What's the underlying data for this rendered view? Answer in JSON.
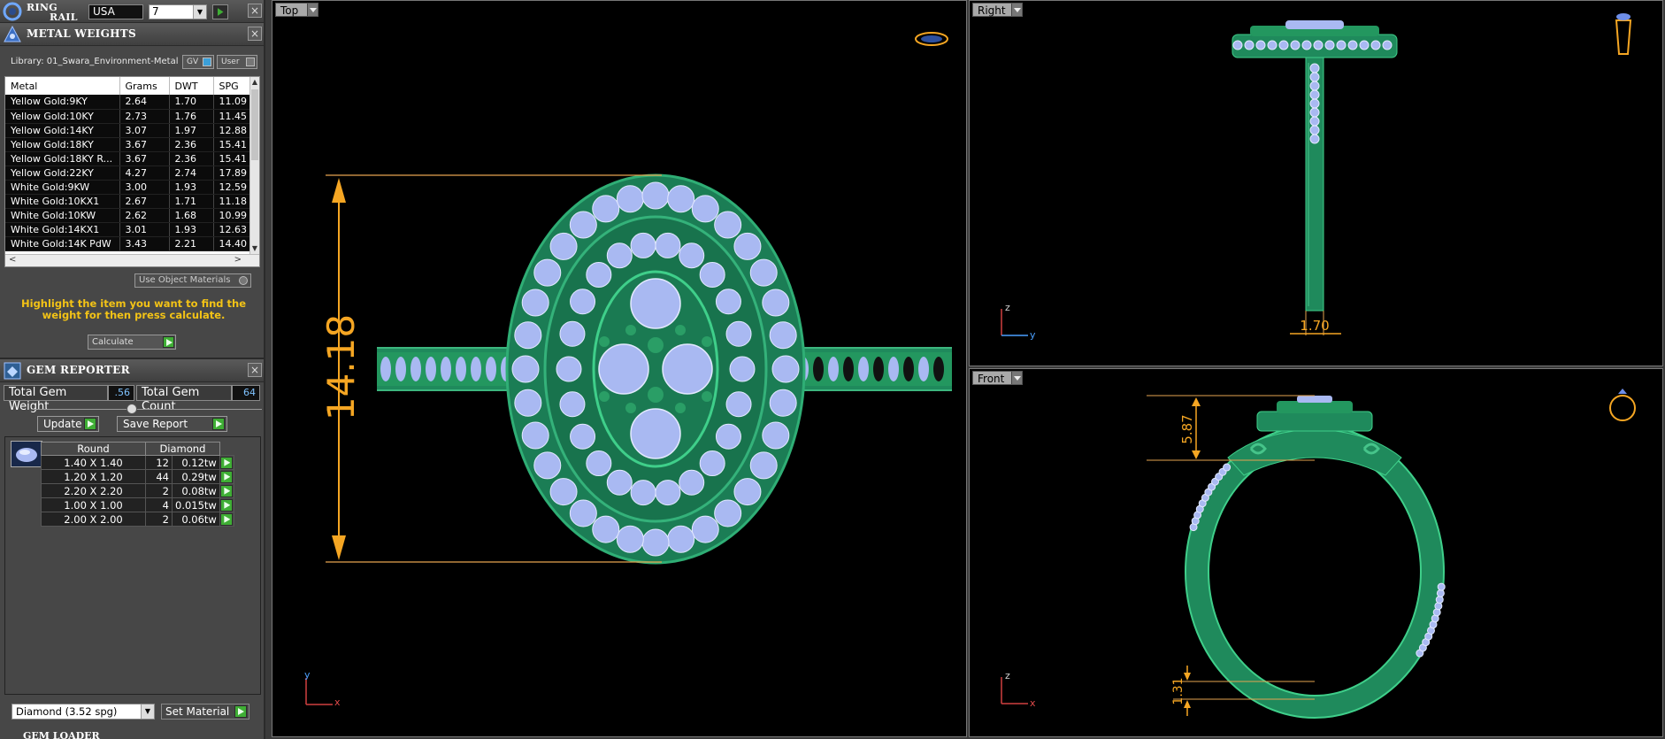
{
  "ring_rail": {
    "title_line1": "RING",
    "title_line2": "RAIL",
    "country": "USA",
    "size": "7"
  },
  "metal_weights": {
    "title": "METAL WEIGHTS",
    "library": "Library: 01_Swara_Environment-Metal",
    "gv_label": "GV",
    "user_label": "User",
    "columns": [
      "Metal",
      "Grams",
      "DWT",
      "SPG"
    ],
    "rows": [
      [
        "Yellow Gold:9KY",
        "2.64",
        "1.70",
        "11.09"
      ],
      [
        "Yellow Gold:10KY",
        "2.73",
        "1.76",
        "11.45"
      ],
      [
        "Yellow Gold:14KY",
        "3.07",
        "1.97",
        "12.88"
      ],
      [
        "Yellow Gold:18KY",
        "3.67",
        "2.36",
        "15.41"
      ],
      [
        "Yellow Gold:18KY R...",
        "3.67",
        "2.36",
        "15.41"
      ],
      [
        "Yellow Gold:22KY",
        "4.27",
        "2.74",
        "17.89"
      ],
      [
        "White Gold:9KW",
        "3.00",
        "1.93",
        "12.59"
      ],
      [
        "White Gold:10KX1",
        "2.67",
        "1.71",
        "11.18"
      ],
      [
        "White Gold:10KW",
        "2.62",
        "1.68",
        "10.99"
      ],
      [
        "White Gold:14KX1",
        "3.01",
        "1.93",
        "12.63"
      ],
      [
        "White Gold:14K PdW",
        "3.43",
        "2.21",
        "14.40"
      ]
    ],
    "use_object_materials": "Use Object Materials",
    "hint": "Highlight the item you want to find the weight for then press calculate.",
    "calculate_label": "Calculate"
  },
  "gem_reporter": {
    "title": "GEM REPORTER",
    "total_weight_label": "Total Gem Weight",
    "total_weight_value": ".56",
    "total_count_label": "Total Gem Count",
    "total_count_value": "64",
    "update_label": "Update",
    "save_report_label": "Save Report",
    "shape_header": "Round",
    "material_header": "Diamond",
    "rows": [
      {
        "size": "1.40 X 1.40",
        "count": "12",
        "weight": "0.12tw"
      },
      {
        "size": "1.20 X 1.20",
        "count": "44",
        "weight": "0.29tw"
      },
      {
        "size": "2.20 X 2.20",
        "count": "2",
        "weight": "0.08tw"
      },
      {
        "size": "1.00 X 1.00",
        "count": "4",
        "weight": "0.015tw"
      },
      {
        "size": "2.00 X 2.00",
        "count": "2",
        "weight": "0.06tw"
      }
    ],
    "material_select": "Diamond    (3.52 spg)",
    "set_material_label": "Set Material"
  },
  "gem_loader": {
    "title": "GEM LOADER"
  },
  "viewports": {
    "top": {
      "label": "Top",
      "dimension": "14.18",
      "axis_v": "y",
      "axis_h": "x"
    },
    "right": {
      "label": "Right",
      "dimension": "1.70",
      "axis_v": "z",
      "axis_h": "y"
    },
    "front": {
      "label": "Front",
      "dimension_top": "5.87",
      "dimension_bottom": "1.31",
      "axis_v": "z",
      "axis_h": "x"
    }
  },
  "colors": {
    "metal_green": "#1f8a5c",
    "gem_blue": "#a9b9f2",
    "dimension_orange": "#f5a623",
    "hint_yellow": "#f3c316",
    "go_green": "#3fae35"
  },
  "icons": [
    "ring-rail-logo",
    "metal-weights-logo",
    "gem-reporter-logo",
    "close-icon",
    "go-arrow-icon",
    "dropdown-icon",
    "top-view-cube-icon",
    "right-view-ring-icon",
    "front-view-ring-icon"
  ]
}
